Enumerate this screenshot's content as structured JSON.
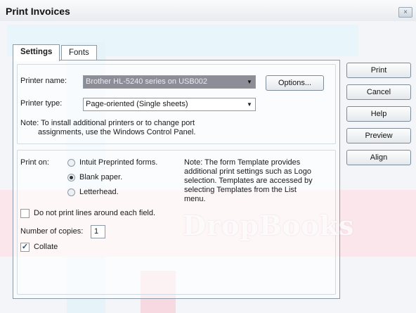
{
  "window": {
    "title": "Print Invoices",
    "close_glyph": "×"
  },
  "tabs": [
    {
      "label": "Settings"
    },
    {
      "label": "Fonts"
    }
  ],
  "printer": {
    "name_label": "Printer name:",
    "name_value": "Brother HL-5240 series on USB002",
    "options_button": "Options...",
    "type_label": "Printer type:",
    "type_value": "Page-oriented (Single sheets)",
    "note_line1": "Note: To install additional printers or to change port",
    "note_line2": "assignments, use the Windows Control Panel."
  },
  "print_on": {
    "label": "Print on:",
    "options": [
      {
        "label": "Intuit Preprinted forms.",
        "selected": false
      },
      {
        "label": "Blank paper.",
        "selected": true
      },
      {
        "label": "Letterhead.",
        "selected": false
      }
    ],
    "note_lines": [
      "Note: The form Template provides",
      "additional print settings such as Logo",
      "selection.  Templates are accessed by",
      "selecting Templates from the List",
      "menu."
    ]
  },
  "options": {
    "no_lines_label": "Do not print lines around each field.",
    "no_lines_checked": false,
    "copies_label": "Number of copies:",
    "copies_value": "1",
    "collate_label": "Collate",
    "collate_checked": true,
    "check_glyph": "✓"
  },
  "buttons": {
    "print": "Print",
    "cancel": "Cancel",
    "help": "Help",
    "preview": "Preview",
    "align": "Align"
  },
  "dropdown_glyph": "▼",
  "watermark": "DropBooks"
}
